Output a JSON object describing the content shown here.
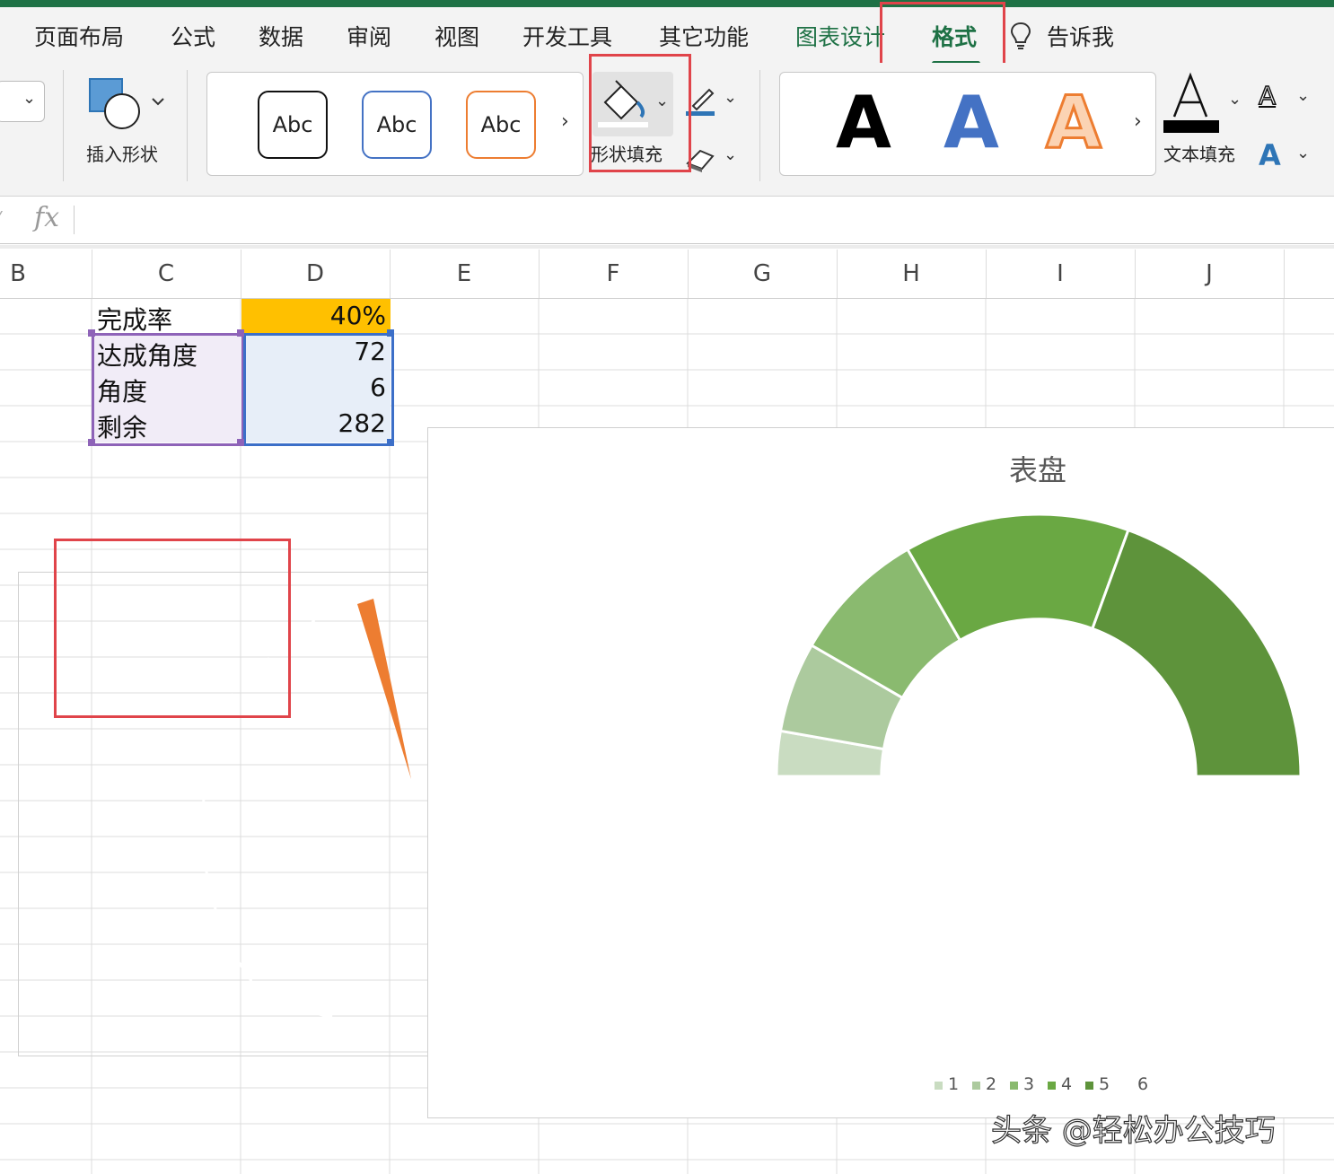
{
  "tabs": [
    {
      "label": "页面布局"
    },
    {
      "label": "公式"
    },
    {
      "label": "数据"
    },
    {
      "label": "审阅"
    },
    {
      "label": "视图"
    },
    {
      "label": "开发工具"
    },
    {
      "label": "其它功能"
    },
    {
      "label": "图表设计"
    },
    {
      "label": "格式"
    },
    {
      "label": "告诉我"
    }
  ],
  "ribbon": {
    "insert_shape_label": "插入形状",
    "style_samples": [
      "Abc",
      "Abc",
      "Abc"
    ],
    "shape_fill_label": "形状填充",
    "wordart_samples": [
      "A",
      "A",
      "A"
    ],
    "text_fill_label": "文本填充",
    "text_outline_glyph": "A",
    "text_effect_glyph": "A",
    "more_glyph": "›"
  },
  "formula_bar": {
    "fx": "fx",
    "value": ""
  },
  "columns": [
    "B",
    "C",
    "D",
    "E",
    "F",
    "G",
    "H",
    "I",
    "J"
  ],
  "table": {
    "rows": [
      {
        "label": "完成率",
        "value": "40%"
      },
      {
        "label": "达成角度",
        "value": "72"
      },
      {
        "label": "角度",
        "value": "6"
      },
      {
        "label": "剩余",
        "value": "282"
      }
    ]
  },
  "colors": {
    "accent": "#1e7145",
    "highlight_cell": "#ffc000",
    "red_box": "#e0444a",
    "pointer": "#ed7d31",
    "segments": [
      "#c9dcc1",
      "#acca9e",
      "#8aba6f",
      "#6aa843",
      "#5e933b"
    ]
  },
  "chart": {
    "title": "表盘",
    "legend": [
      "1",
      "2",
      "3",
      "4",
      "5",
      "6"
    ],
    "watermark": "头条 @轻松办公技巧"
  },
  "chart_data": {
    "type": "pie",
    "title": "表盘",
    "categories": [
      "1",
      "2",
      "3",
      "4",
      "5",
      "6"
    ],
    "values": [
      10,
      20,
      30,
      50,
      70,
      180
    ],
    "hole": 0.6,
    "start_angle_deg": 270,
    "last_slice_hidden": true,
    "legend_position": "bottom"
  }
}
